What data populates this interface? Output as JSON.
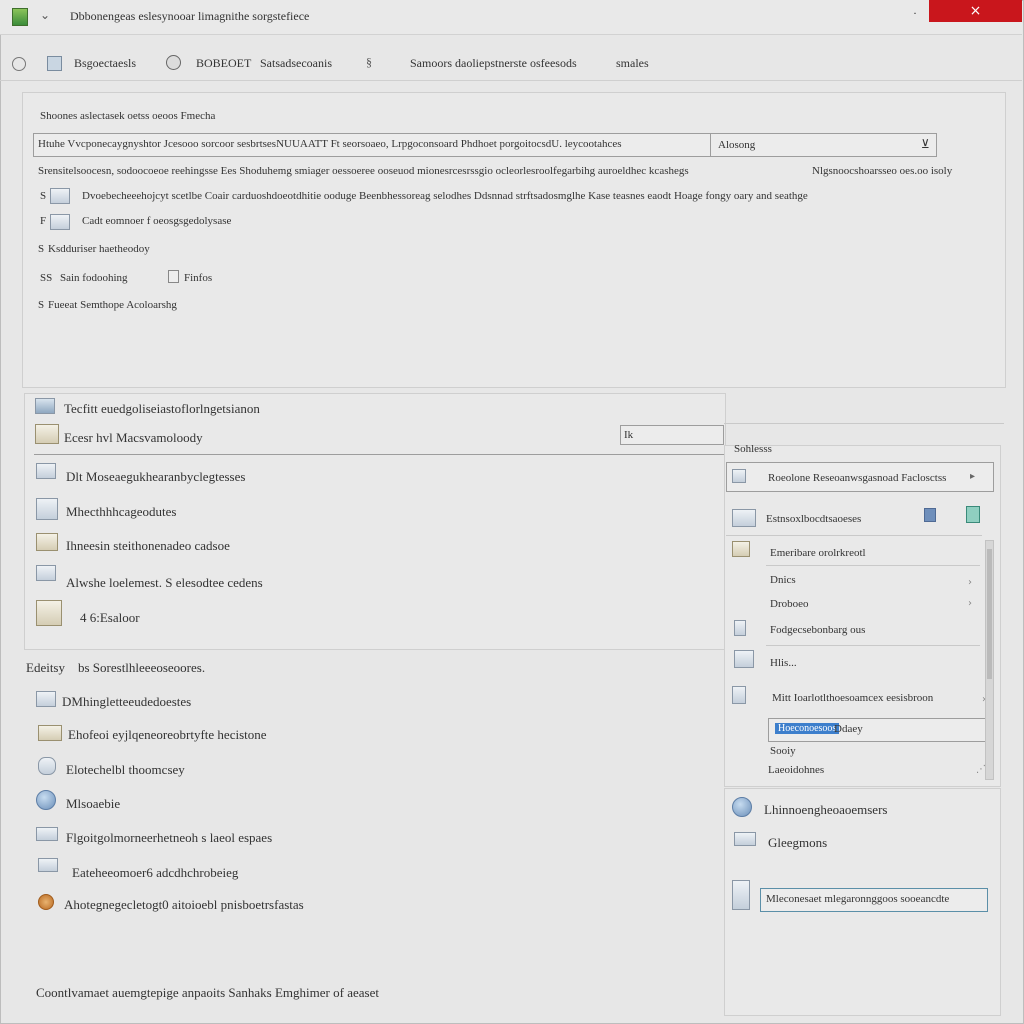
{
  "window": {
    "title": "Dbbonengeas eslesynooar limagnithe sorgstefiece",
    "close_glyph": "×",
    "min_glyph": "·",
    "accent_close": "#c9161c"
  },
  "toolbar": {
    "items": [
      {
        "label": "Bsgoectaesls",
        "icon": "folder-icon"
      },
      {
        "label": "BOBEOET",
        "icon": "settings-icon"
      },
      {
        "label": "Satsadsecoanis",
        "icon": "none"
      },
      {
        "label": "Samoors daoliepstnerste osfeesods",
        "icon": "help-icon"
      },
      {
        "label": "smales",
        "icon": "none"
      }
    ]
  },
  "top_panel": {
    "heading": "Shoones aslectasek oetss oeoos Fmecha",
    "field_value": "Htuhe Vvcponecaygnyshtor Jcesooo sorcoor sesbrtsesNUUAATT Ft seorsoaeo, Lrpgoconsoard Phdhoet porgoitocsdU. leycootahces",
    "field_right": "Alosong",
    "field_caret": "⊻",
    "desc_line": "Srensitelsoocesn, sodoocoeoe reehingsse Ees Shoduhemg smiager oessoeree ooseuod mionesrcesrssgio ocleorlesroolfegarbihg auroeldhec kcashegs",
    "desc_right": "Nlgsnoocshoarsseo oes.oo isoly",
    "rows": [
      {
        "prefix": "S",
        "text": "Dvoebecheeehojcyt scetlbe Coair carduoshdoeotdhitie ooduge Beenbhessoreag selodhes Ddsnnad strftsadosmglhe Kase teasnes eaodt Hoage fongy oary and seathge"
      },
      {
        "prefix": "F",
        "text": "Cadt eomnoer f oeosgsgedolysase"
      },
      {
        "prefix": "S",
        "text": "Ksdduriser haetheodoy"
      },
      {
        "prefix": "SS",
        "text": "Sain fodoohing",
        "extra": "Finfos"
      },
      {
        "prefix": "S",
        "text": "Fueeat Semthope Acoloarshg"
      }
    ]
  },
  "middle_panel": {
    "title": "Tecfitt euedgoliseiastoflorlngetsianon",
    "search_value": "Ecesr hvl Macsvamoloody",
    "filter_value": "Ik",
    "items": [
      "Dlt Moseaegukhearanbyclegtesses",
      "Mhecthhhcageodutes",
      "Ihneesin steithonenadeo cadsoe",
      "Alwshe loelemest. S elesodtee cedens",
      "4 6:Esaloor"
    ]
  },
  "right_panel": {
    "header": "Sohlesss",
    "dropdown_value": "Roeolone Reseoanwsgasnoad Faclosctss",
    "group_title": "Estnsoxlbocdtsaoeses",
    "subheader": "Emeribare orolrkreotl",
    "items": [
      {
        "label": "Dnics"
      },
      {
        "label": "Droboeo"
      },
      {
        "label": "Fodgecsebonbarg ous"
      },
      {
        "label": "Hlis..."
      },
      {
        "label": "Mitt Ioarlotlthoesoamcex eesisbroon"
      }
    ],
    "selected_chip": "Hoeconoesoos",
    "selected_text": "Ddaey",
    "field_a": "Sooiy",
    "field_b": "Laeoidohnes",
    "lower_items": [
      "Lhinnoengheoaoemsers",
      "Gleegmons"
    ],
    "bottom_field": "Mleconesaet mlegaronnggoos sooeancdte"
  },
  "bottom_section": {
    "header_a": "Edeitsy",
    "header_b": "bs Sorestlhleeeoseoores.",
    "items": [
      "DMhingletteeudedoestes",
      "Ehofeoi eyjlqeneoreobrtyfte hecistone",
      "Elotechelbl thoomcsey",
      "Mlsoaebie",
      "Flgoitgolmorneerhetneoh s laeol espaes",
      "Eateheeomoer6 adcdhchrobeieg",
      "Ahotegnegecletogt0 aitoioebl pnisboetrsfastas"
    ],
    "footer": "Coontlvamaet auemgtepige anpaoits Sanhaks Emghimer of aeaset"
  }
}
